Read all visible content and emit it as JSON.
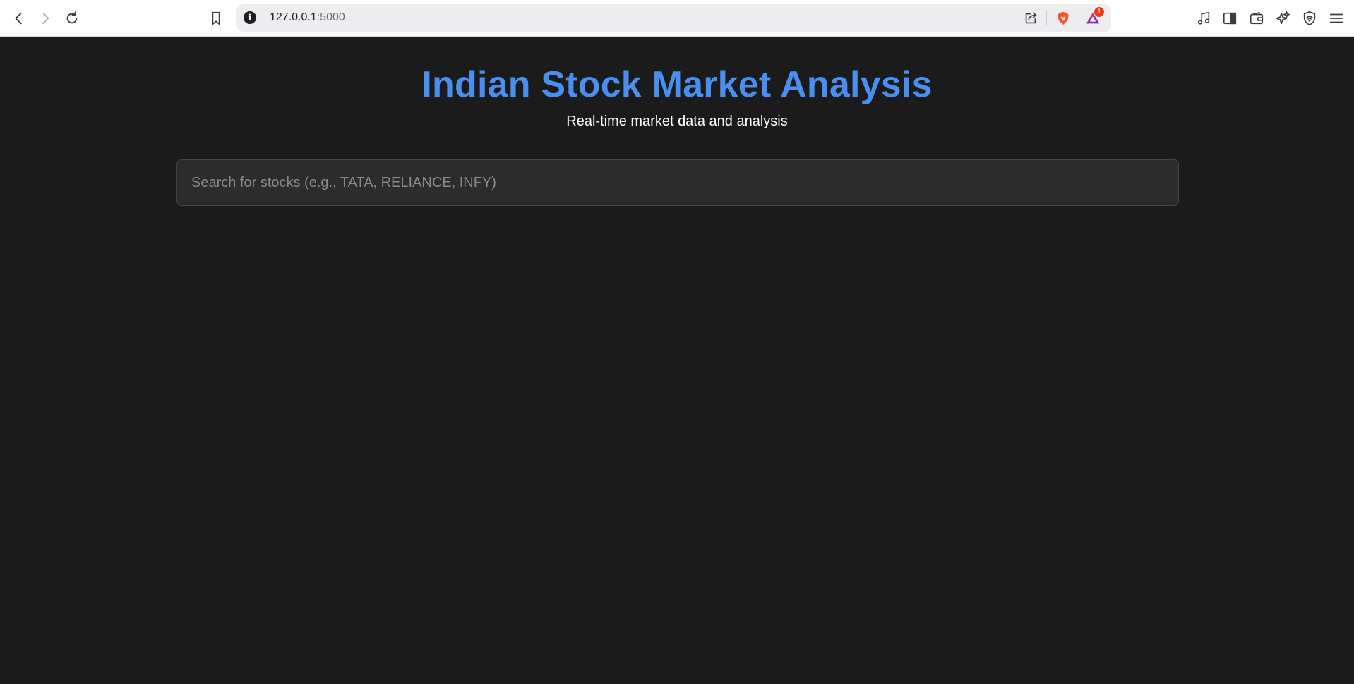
{
  "browser": {
    "url_host": "127.0.0.1",
    "url_port": ":5000",
    "site_info_glyph": "i",
    "rewards_badge_count": "1",
    "icons": {
      "back": "chevron-left-icon",
      "forward": "chevron-right-icon",
      "reload": "reload-icon",
      "bookmark": "bookmark-icon",
      "share": "share-icon",
      "shields": "brave-lion-icon",
      "rewards": "brave-rewards-icon",
      "media": "music-note-icon",
      "sidebar": "sidebar-icon",
      "wallet": "wallet-icon",
      "leo": "sparkle-icon",
      "vpn": "shield-wifi-icon",
      "menu": "hamburger-menu-icon"
    }
  },
  "page": {
    "title": "Indian Stock Market Analysis",
    "subtitle": "Real-time market data and analysis",
    "search": {
      "placeholder": "Search for stocks (e.g., TATA, RELIANCE, INFY)",
      "value": ""
    }
  },
  "colors": {
    "background": "#1b1b1b",
    "title": "#4a8ff0",
    "search_bg": "#2c2c2c",
    "brave_orange": "#fb542b"
  }
}
